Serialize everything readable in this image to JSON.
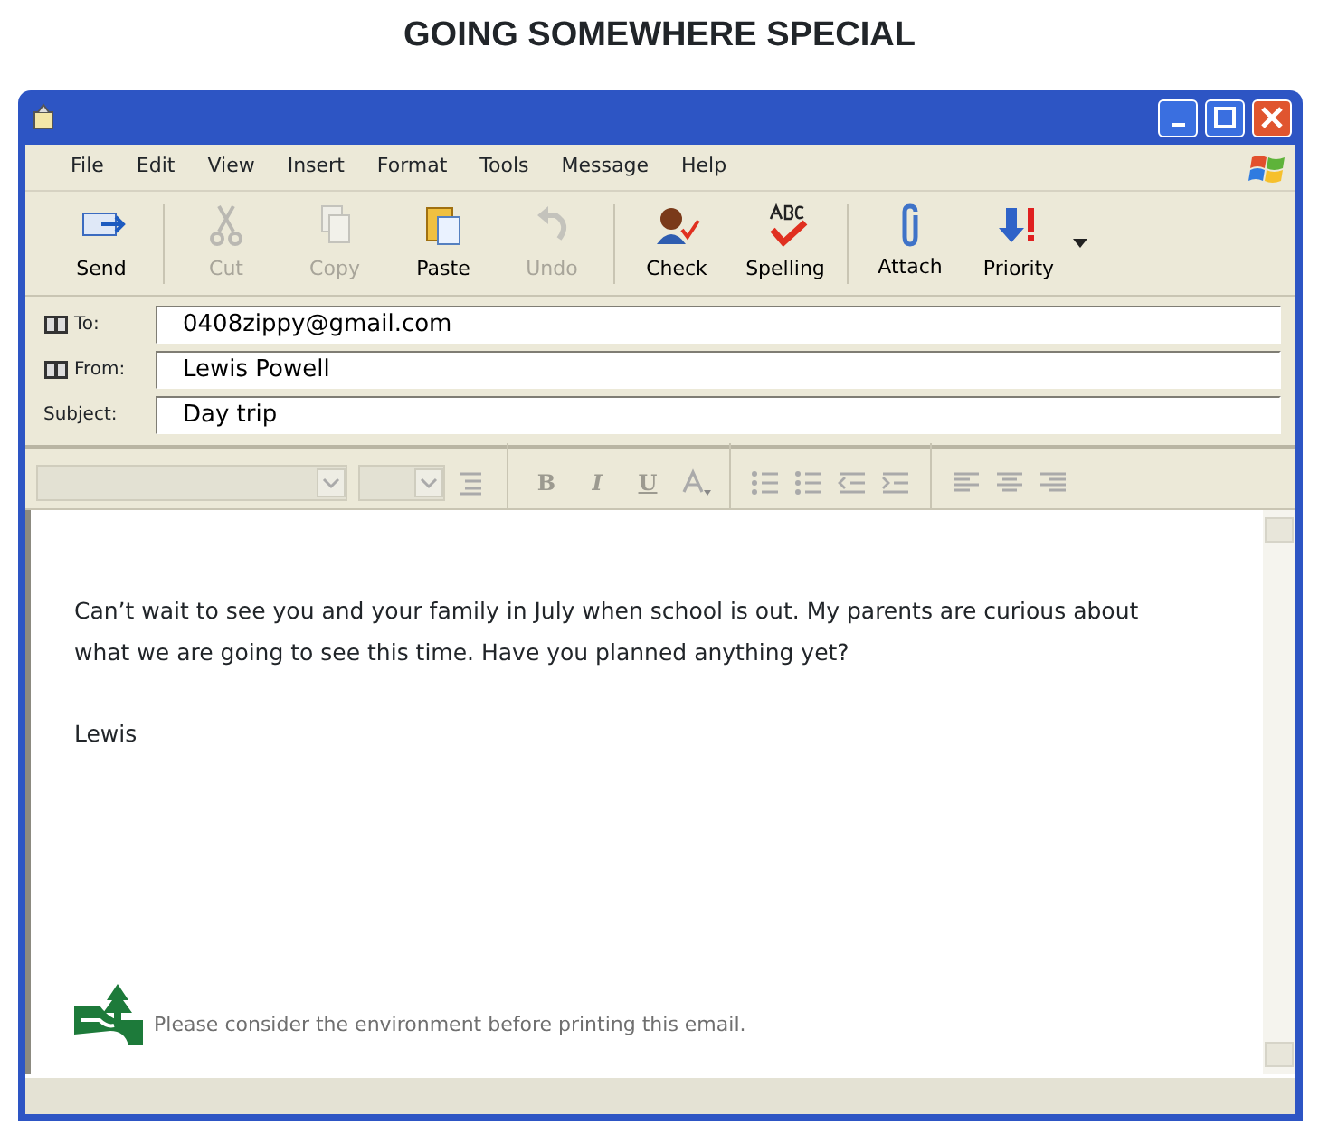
{
  "heading": "GOING SOMEWHERE SPECIAL",
  "menu": [
    "File",
    "Edit",
    "View",
    "Insert",
    "Format",
    "Tools",
    "Message",
    "Help"
  ],
  "toolbar": [
    {
      "kind": "send",
      "label": "Send",
      "disabled": false
    },
    {
      "kind": "cut",
      "label": "Cut",
      "disabled": true
    },
    {
      "kind": "copy",
      "label": "Copy",
      "disabled": true
    },
    {
      "kind": "paste",
      "label": "Paste",
      "disabled": false
    },
    {
      "kind": "undo",
      "label": "Undo",
      "disabled": true
    },
    {
      "kind": "check",
      "label": "Check",
      "disabled": false
    },
    {
      "kind": "spelling",
      "label": "Spelling",
      "disabled": false
    },
    {
      "kind": "attach",
      "label": "Attach",
      "disabled": false
    },
    {
      "kind": "priority",
      "label": "Priority",
      "disabled": false
    }
  ],
  "fields": [
    {
      "label": "To:",
      "value": "0408zippy@gmail.com",
      "book": true
    },
    {
      "label": "From:",
      "value": "Lewis Powell",
      "book": true
    },
    {
      "label": "Subject:",
      "value": "Day trip",
      "book": false
    }
  ],
  "format_bar": [
    {
      "kind": "bold",
      "label": "B"
    },
    {
      "kind": "italic",
      "label": "I"
    },
    {
      "kind": "underline",
      "label": "U"
    }
  ],
  "body": {
    "paragraphs": [
      "Can’t wait to see you and your family in July when school is out. My parents are curious about what we are going to see this time. Have you planned anything yet?",
      "Lewis"
    ],
    "footer": "Please consider the environment before printing this email."
  }
}
